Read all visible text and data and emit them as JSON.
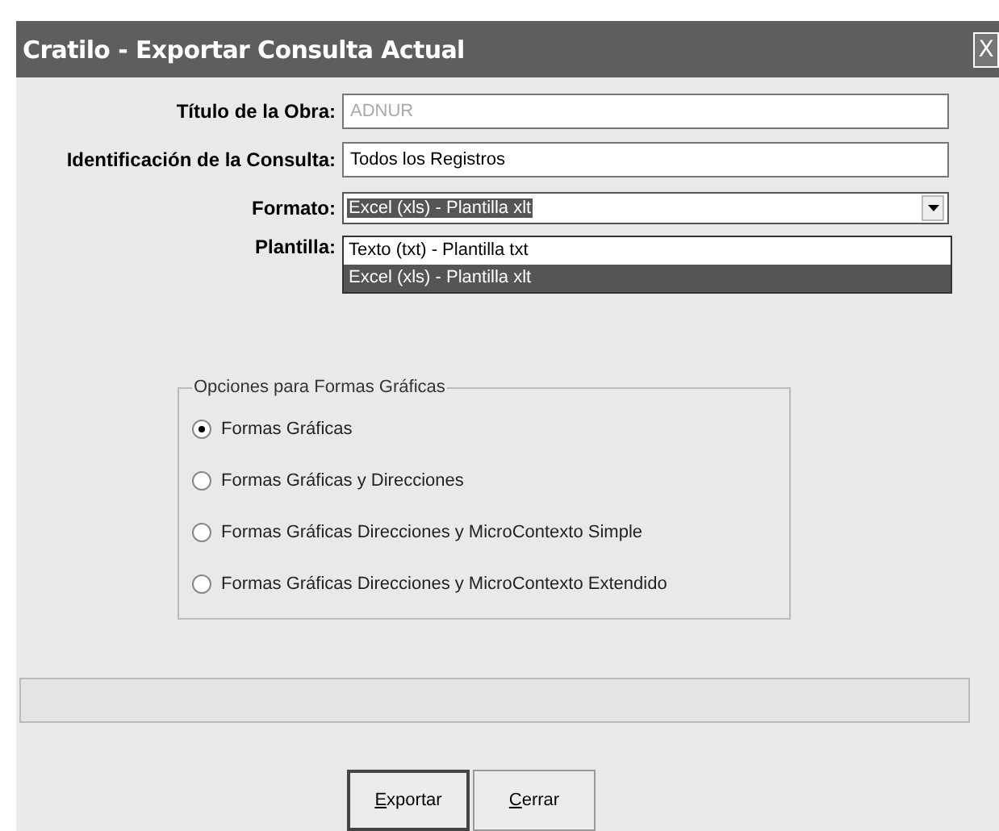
{
  "window": {
    "title": "Cratilo - Exportar Consulta Actual",
    "close": "X"
  },
  "fields": [
    {
      "label": "Título de la Obra:",
      "value": "ADNUR",
      "disabled": true
    },
    {
      "label": "Identificación de la Consulta:",
      "value": "Todos los Registros",
      "disabled": false
    }
  ],
  "formato": {
    "label": "Formato:",
    "value": "Excel (xls) - Plantilla xlt",
    "focused": true,
    "expanded": true,
    "options": [
      {
        "label": "Texto (txt) - Plantilla txt",
        "selected": false
      },
      {
        "label": "Excel (xls) - Plantilla xlt",
        "selected": true
      }
    ]
  },
  "plantilla": {
    "label": "Plantilla:"
  },
  "group": {
    "title": "Opciones para Formas Gráficas",
    "options": [
      {
        "label": "Formas Gráficas",
        "selected": true
      },
      {
        "label": "Formas Gráficas y Direcciones",
        "selected": false
      },
      {
        "label": "Formas Gráficas Direcciones y MicroContexto Simple",
        "selected": false
      },
      {
        "label": "Formas Gráficas Direcciones y MicroContexto Extendido",
        "selected": false
      }
    ]
  },
  "progress": {
    "level": 0
  },
  "buttons": [
    {
      "label": "Exportar",
      "default": true
    },
    {
      "label": "Cerrar",
      "default": false
    }
  ]
}
